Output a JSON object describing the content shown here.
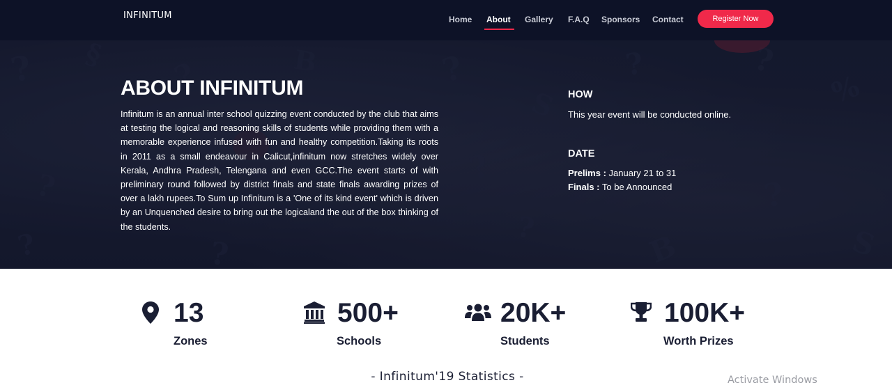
{
  "nav": {
    "logo": "INFINITUM",
    "links": [
      {
        "label": "Home"
      },
      {
        "label": "About"
      },
      {
        "label": "Gallery"
      },
      {
        "label": "F.A.Q"
      },
      {
        "label": "Sponsors"
      },
      {
        "label": "Contact"
      }
    ],
    "active": "About",
    "register_label": "Register Now"
  },
  "about": {
    "title": "ABOUT INFINITUM",
    "body": "Infinitum is an annual inter school quizzing event conducted by the club that aims at testing the logical and reasoning skills of students while providing them with a memorable experience infused with fun and healthy competition.Taking its roots in 2011 as a small endeavour in Calicut,infinitum now stretches widely over Kerala, Andhra Pradesh, Telengana and even GCC.The event starts of with preliminary round followed by district finals and state finals awarding prizes of over a lakh rupees.To Sum up Infinitum is a 'One of its kind event' which is driven by an Unquenched desire to bring out the logicaland the out of the box thinking of the students."
  },
  "how": {
    "heading": "HOW",
    "text": "This year event will be conducted online."
  },
  "date": {
    "heading": "DATE",
    "prelims_label": "Prelims :",
    "prelims_value": "January 21 to 31",
    "finals_label": "Finals :",
    "finals_value": "To be Announced"
  },
  "stats": [
    {
      "icon": "map-marker-icon",
      "value": "13",
      "label": "Zones"
    },
    {
      "icon": "institution-icon",
      "value": "500+",
      "label": "Schools"
    },
    {
      "icon": "users-icon",
      "value": "20K+",
      "label": "Students"
    },
    {
      "icon": "trophy-icon",
      "value": "100K+",
      "label": "Worth Prizes"
    }
  ],
  "stats_caption": "-  Infinitum'19  Statistics  -",
  "watermark": "Activate Windows",
  "colors": {
    "nav_bg": "#0d1227",
    "accent": "#f0294a",
    "stat_text": "#1a1e33"
  }
}
